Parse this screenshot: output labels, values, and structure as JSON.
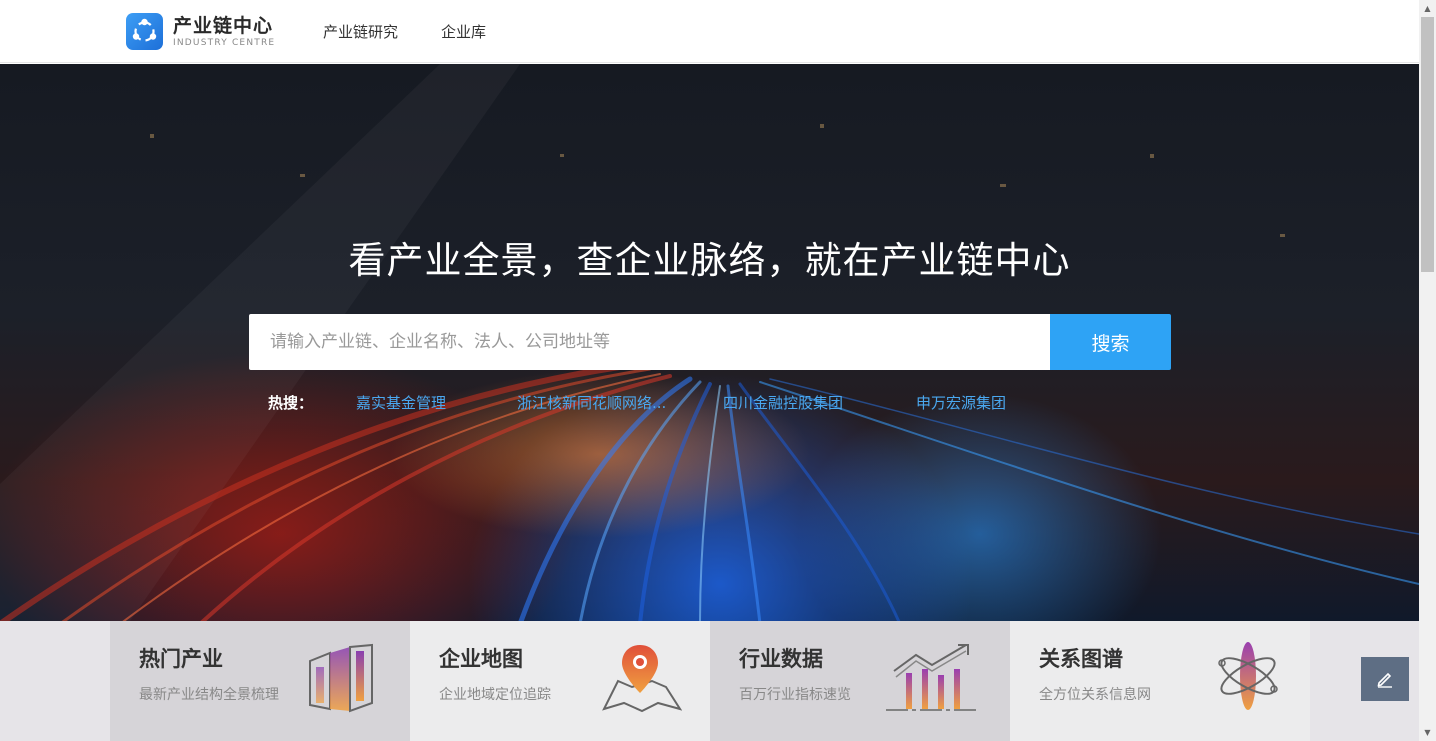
{
  "header": {
    "logo_title": "产业链中心",
    "logo_sub": "INDUSTRY CENTRE",
    "nav": [
      {
        "label": "产业链研究"
      },
      {
        "label": "企业库"
      }
    ]
  },
  "hero": {
    "title": "看产业全景，查企业脉络，就在产业链中心",
    "search_placeholder": "请输入产业链、企业名称、法人、公司地址等",
    "search_button": "搜索",
    "hot_label": "热搜：",
    "hot_items": [
      {
        "label": "嘉实基金管理"
      },
      {
        "label": "浙江核新同花顺网络..."
      },
      {
        "label": "四川金融控股集团"
      },
      {
        "label": "申万宏源集团"
      }
    ]
  },
  "cards": [
    {
      "title": "热门产业",
      "desc": "最新产业结构全景梳理",
      "icon": "building-chart-icon",
      "bg": "#d6d4d8"
    },
    {
      "title": "企业地图",
      "desc": "企业地域定位追踪",
      "icon": "map-pin-icon",
      "bg": "#ececed"
    },
    {
      "title": "行业数据",
      "desc": "百万行业指标速览",
      "icon": "growth-chart-icon",
      "bg": "#d6d4d8"
    },
    {
      "title": "关系图谱",
      "desc": "全方位关系信息网",
      "icon": "atom-icon",
      "bg": "#ececed"
    }
  ],
  "colors": {
    "accent": "#2ea3f5",
    "hot_link": "#4aa8f0"
  }
}
